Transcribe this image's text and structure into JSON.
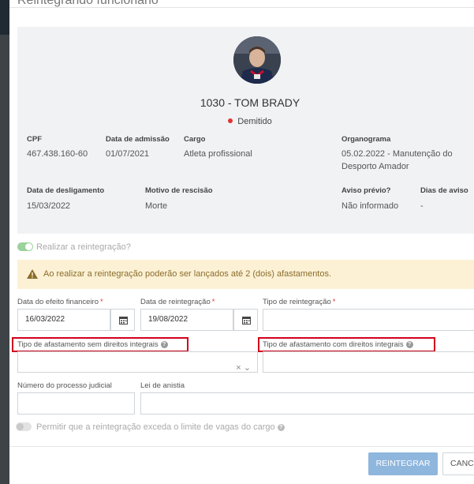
{
  "modal": {
    "title": "Reintegrando funcionário"
  },
  "employee": {
    "name": "1030 - TOM BRADY",
    "status": "Demitido",
    "status_color": "#e03535"
  },
  "fields": {
    "cpf_label": "CPF",
    "cpf_value": "467.438.160-60",
    "admissao_label": "Data de admissão",
    "admissao_value": "01/07/2021",
    "cargo_label": "Cargo",
    "cargo_value": "Atleta profissional",
    "organograma_label": "Organograma",
    "organograma_value_1": "05.02.2022 - Manutenção do",
    "organograma_value_2": "Desporto Amador",
    "desligamento_label": "Data de desligamento",
    "desligamento_value": "15/03/2022",
    "motivo_label": "Motivo de rescisão",
    "motivo_value": "Morte",
    "aviso_label": "Aviso prévio?",
    "aviso_value": "Não informado",
    "dias_aviso_label": "Dias de aviso",
    "dias_aviso_value": "-"
  },
  "toggles": {
    "realizar_label": "Realizar a reintegração?",
    "realizar_on": true,
    "permitir_label": "Permitir que a reintegração exceda o limite de vagas do cargo",
    "permitir_on": false
  },
  "alert": {
    "text": "Ao realizar a reintegração poderão ser lançados até 2 (dois) afastamentos."
  },
  "form": {
    "efeito_label": "Data do efeito financeiro",
    "efeito_value": "16/03/2022",
    "reintegracao_label": "Data de reintegração",
    "reintegracao_value": "19/08/2022",
    "tipo_reintegracao_label": "Tipo de reintegração",
    "required_mark": "*",
    "sem_direitos_label": "Tipo de afastamento sem direitos integrais",
    "com_direitos_label": "Tipo de afastamento com direitos integrais",
    "processo_label": "Número do processo judicial",
    "anistia_label": "Lei de anistia",
    "select_clear": "×",
    "select_chevron": "⌄"
  },
  "buttons": {
    "reintegrar": "REINTEGRAR",
    "cancelar": "CANCELAR"
  },
  "colors": {
    "accent": "#8fb6dd",
    "toggle_on": "#7cc47c",
    "highlight": "#d0021b",
    "alert_bg": "#fcf1d5"
  }
}
